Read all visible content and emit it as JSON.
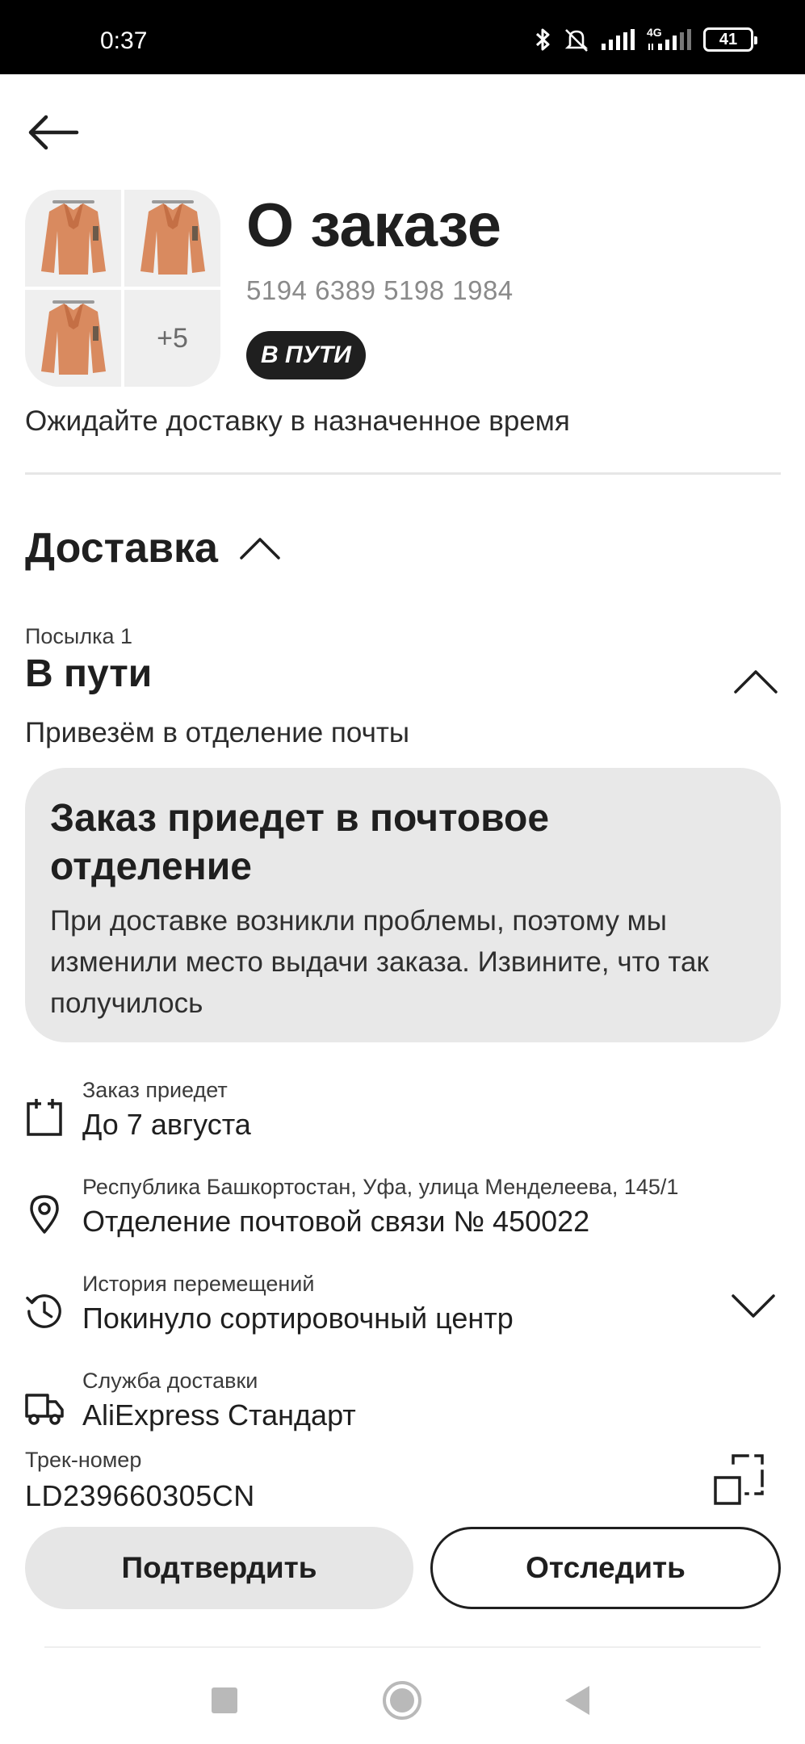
{
  "status_bar": {
    "time": "0:37",
    "network": "4G",
    "battery": "41"
  },
  "header": {
    "title": "О заказе",
    "order_number": "5194 6389 5198 1984",
    "status_badge": "В ПУТИ",
    "extra_items": "+5"
  },
  "delivery_note": "Ожидайте доставку в назначенное время",
  "delivery_section": {
    "title": "Доставка"
  },
  "parcel": {
    "label": "Посылка 1",
    "status": "В пути",
    "subtitle": "Привезём в отделение почты"
  },
  "info_card": {
    "title": "Заказ приедет в почтовое отделение",
    "text": "При доставке возникли проблемы, поэтому мы изменили место выдачи заказа. Извините, что так получилось"
  },
  "details": {
    "arrival": {
      "label": "Заказ приедет",
      "value": "До 7 августа"
    },
    "address": {
      "label": "Республика Башкортостан, Уфа, улица Менделеева, 145/1",
      "value": "Отделение почтовой связи № 450022"
    },
    "history": {
      "label": "История перемещений",
      "value": "Покинуло сортировочный центр"
    },
    "service": {
      "label": "Служба доставки",
      "value": "AliExpress Стандарт"
    }
  },
  "tracking": {
    "label": "Трек-номер",
    "value": "LD239660305CN"
  },
  "buttons": {
    "confirm": "Подтвердить",
    "track": "Отследить"
  },
  "colors": {
    "text": "#1f1f1f",
    "secondary": "#8a8a8a",
    "card_bg": "#e8e8e8",
    "badge_bg": "#1f1f1f",
    "jacket": "#d98a5f"
  }
}
